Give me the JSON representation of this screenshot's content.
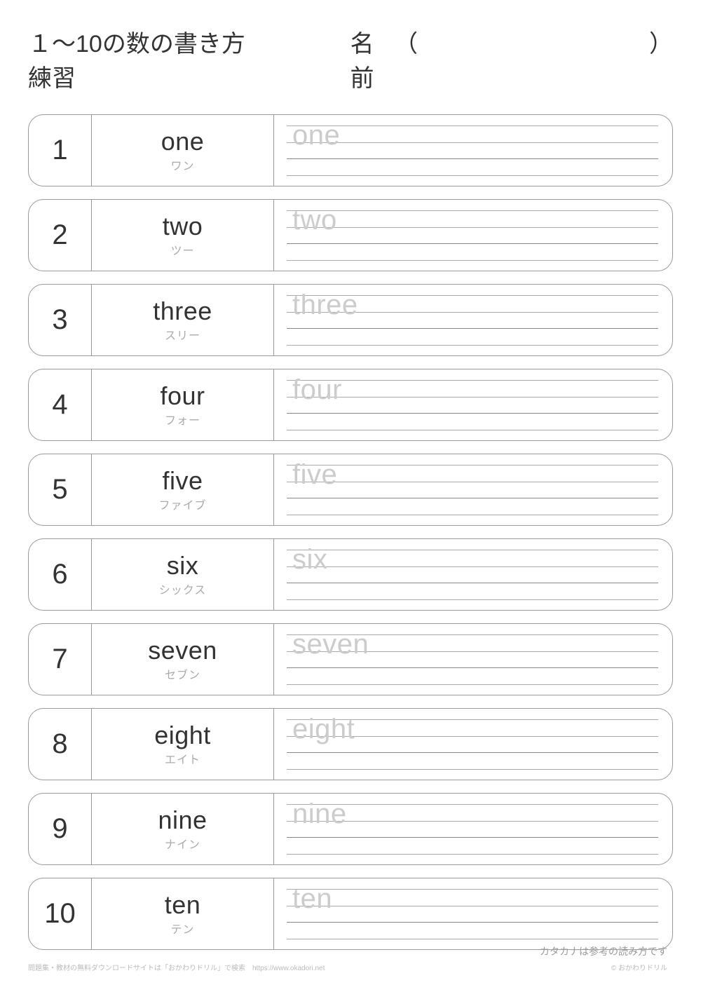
{
  "header": {
    "title": "１～10の数の書き方練習",
    "name_label": "名前",
    "paren_open": "（",
    "paren_close": "）"
  },
  "rows": [
    {
      "number": "1",
      "english": "one",
      "katakana": "ワン",
      "trace": "one"
    },
    {
      "number": "2",
      "english": "two",
      "katakana": "ツー",
      "trace": "two"
    },
    {
      "number": "3",
      "english": "three",
      "katakana": "スリー",
      "trace": "three"
    },
    {
      "number": "4",
      "english": "four",
      "katakana": "フォー",
      "trace": "four"
    },
    {
      "number": "5",
      "english": "five",
      "katakana": "ファイブ",
      "trace": "five"
    },
    {
      "number": "6",
      "english": "six",
      "katakana": "シックス",
      "trace": "six"
    },
    {
      "number": "7",
      "english": "seven",
      "katakana": "セブン",
      "trace": "seven"
    },
    {
      "number": "8",
      "english": "eight",
      "katakana": "エイト",
      "trace": "eight"
    },
    {
      "number": "9",
      "english": "nine",
      "katakana": "ナイン",
      "trace": "nine"
    },
    {
      "number": "10",
      "english": "ten",
      "katakana": "テン",
      "trace": "ten"
    }
  ],
  "footer": {
    "note": "カタカナは参考の読み方です",
    "left": "問題集・教材の無料ダウンロードサイトは「おかわりドリル」で検索　https://www.okadori.net",
    "right": "© おかわりドリル"
  }
}
